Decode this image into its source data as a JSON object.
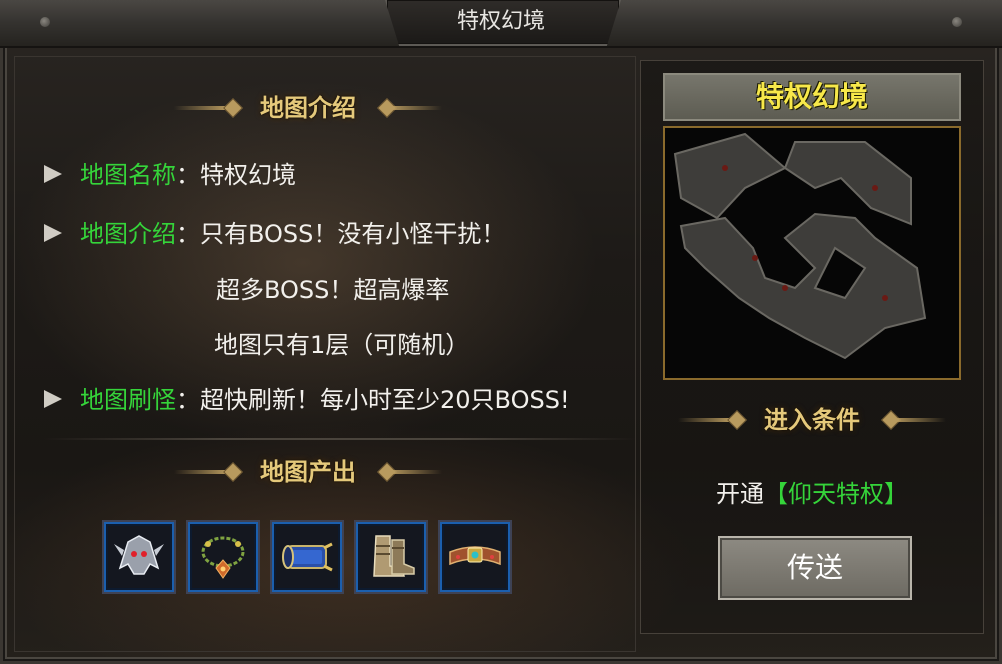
{
  "window": {
    "title": "特权幻境"
  },
  "intro_section": {
    "header": "地图介绍"
  },
  "info": {
    "name_key": "地图名称",
    "name_val": "特权幻境",
    "intro_key": "地图介绍",
    "intro_lines": [
      "只有BOSS！没有小怪干扰！",
      "超多BOSS！超高爆率",
      "地图只有1层（可随机）"
    ],
    "refresh_key": "地图刷怪",
    "refresh_val": "超快刷新！每小时至少20只BOSS!",
    "separator": "："
  },
  "output_section": {
    "header": "地图产出",
    "items": [
      {
        "icon": "helmet-icon"
      },
      {
        "icon": "necklace-icon"
      },
      {
        "icon": "bracer-icon"
      },
      {
        "icon": "boots-icon"
      },
      {
        "icon": "belt-icon"
      }
    ]
  },
  "right": {
    "map_title": "特权幻境",
    "condition_header": "进入条件",
    "condition_prefix": "开通",
    "condition_tag": "【仰天特权】",
    "teleport_label": "传送"
  },
  "colors": {
    "key_green": "#35d43a",
    "gold": "#e5c97b",
    "title_yellow": "#f7e84a"
  }
}
